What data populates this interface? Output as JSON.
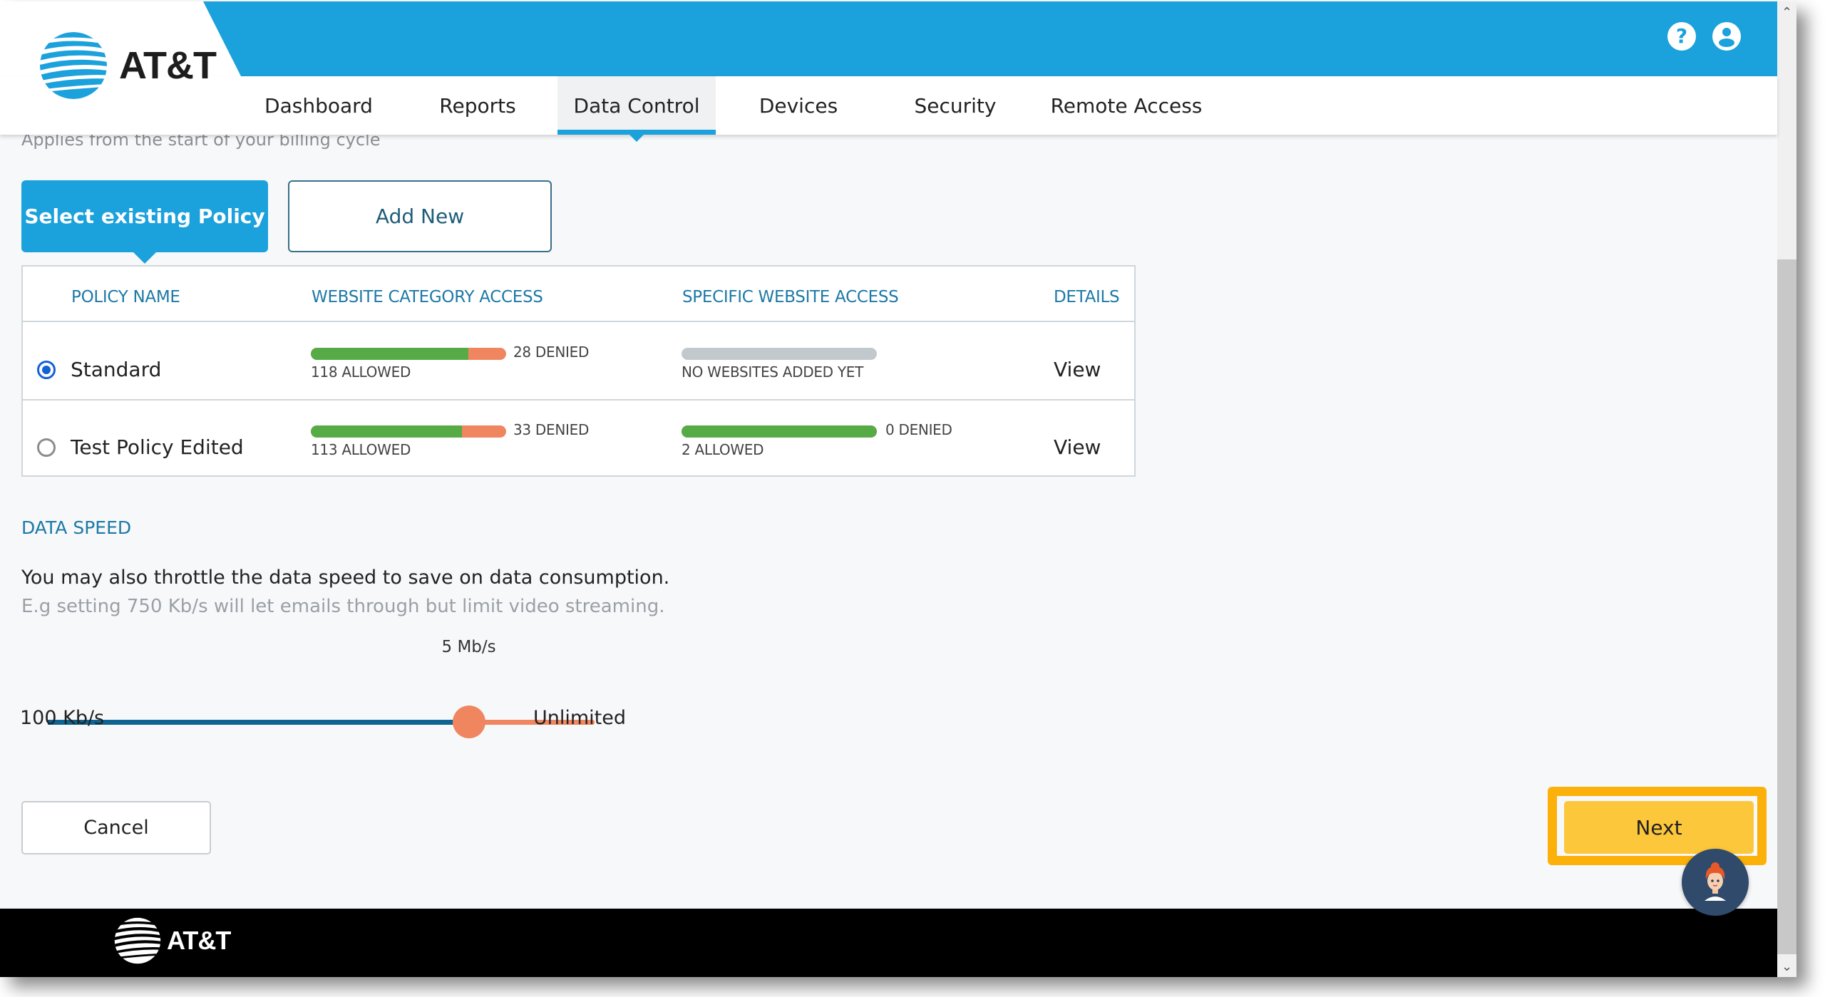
{
  "brand": {
    "name": "AT&T",
    "accent": "#1ba1dc",
    "footer_bg": "#000000"
  },
  "header": {
    "icons": [
      {
        "name": "help-icon",
        "glyph": "?"
      },
      {
        "name": "user-account-icon"
      }
    ]
  },
  "nav": {
    "tabs": [
      {
        "label": "Dashboard",
        "active": false
      },
      {
        "label": "Reports",
        "active": false
      },
      {
        "label": "Data Control",
        "active": true
      },
      {
        "label": "Devices",
        "active": false
      },
      {
        "label": "Security",
        "active": false
      },
      {
        "label": "Remote Access",
        "active": false
      }
    ]
  },
  "main": {
    "applies_text": "Applies from the start of your billing cycle",
    "segment": {
      "select_existing_label": "Select existing Policy",
      "add_new_label": "Add New",
      "selected": "Select existing Policy"
    },
    "table": {
      "headers": [
        "POLICY NAME",
        "WEBSITE CATEGORY ACCESS",
        "SPECIFIC WEBSITE ACCESS",
        "DETAILS"
      ],
      "rows": [
        {
          "name": "Standard",
          "selected": true,
          "category": {
            "allowed": 118,
            "denied": 28,
            "allowed_label": "118 ALLOWED",
            "denied_label": "28 DENIED"
          },
          "specific": {
            "empty": true,
            "empty_label": "NO WEBSITES ADDED YET"
          },
          "details_label": "View"
        },
        {
          "name": "Test Policy Edited",
          "selected": false,
          "category": {
            "allowed": 113,
            "denied": 33,
            "allowed_label": "113 ALLOWED",
            "denied_label": "33 DENIED"
          },
          "specific": {
            "allowed": 2,
            "denied": 0,
            "allowed_label": "2 ALLOWED",
            "denied_label": "0 DENIED"
          },
          "details_label": "View"
        }
      ],
      "colors": {
        "allowed": "#56ab47",
        "denied": "#ef8660",
        "empty": "#c2c9cd"
      }
    },
    "data_speed": {
      "title": "DATA SPEED",
      "description": "You may also throttle the data speed to save on data consumption.",
      "hint": "E.g setting 750 Kb/s will let emails through but limit video streaming.",
      "slider": {
        "value_label": "5 Mb/s",
        "position_fraction": 0.77,
        "min_label": "100 Kb/s",
        "max_label": "Unlimited"
      }
    },
    "actions": {
      "cancel_label": "Cancel",
      "next_label": "Next"
    }
  },
  "footer": {
    "logo_text": "AT&T"
  }
}
